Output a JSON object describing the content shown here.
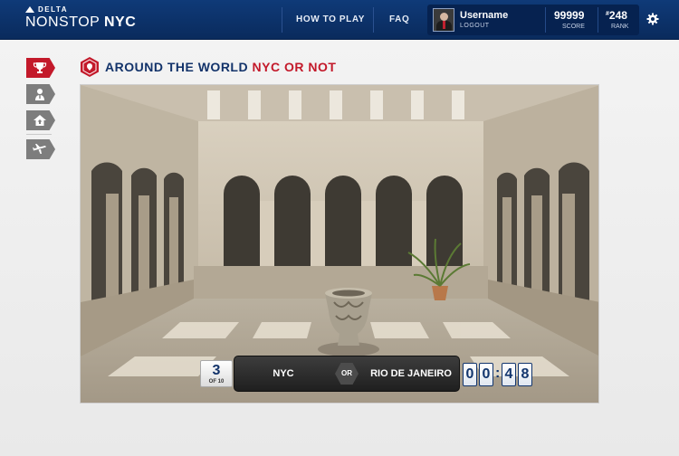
{
  "brand": {
    "top": "DELTA",
    "main_a": "NONSTOP",
    "main_b": "NYC"
  },
  "nav": {
    "how_to_play": "HOW TO PLAY",
    "faq": "FAQ"
  },
  "user": {
    "name": "Username",
    "logout": "LOGOUT",
    "score": "99999",
    "score_label": "SCORE",
    "rank_prefix": "#",
    "rank": "248",
    "rank_label": "RANK"
  },
  "sidebar": {
    "items": [
      {
        "icon": "trophy-icon",
        "active": true
      },
      {
        "icon": "person-icon",
        "active": false
      },
      {
        "icon": "home-up-icon",
        "active": false
      },
      {
        "icon": "airplane-icon",
        "active": false
      }
    ]
  },
  "title": {
    "main": "AROUND THE WORLD ",
    "accent": "NYC OR NOT"
  },
  "game": {
    "question_number": "3",
    "question_total": "OF 10",
    "choice_a": "NYC",
    "or_label": "OR",
    "choice_b": "RIO DE JANEIRO",
    "timer_digits": [
      "0",
      "0",
      "4",
      "8"
    ],
    "timer_sep": ":"
  },
  "colors": {
    "header": "#0a2b5d",
    "accent": "#c3192a",
    "title": "#13336a"
  }
}
